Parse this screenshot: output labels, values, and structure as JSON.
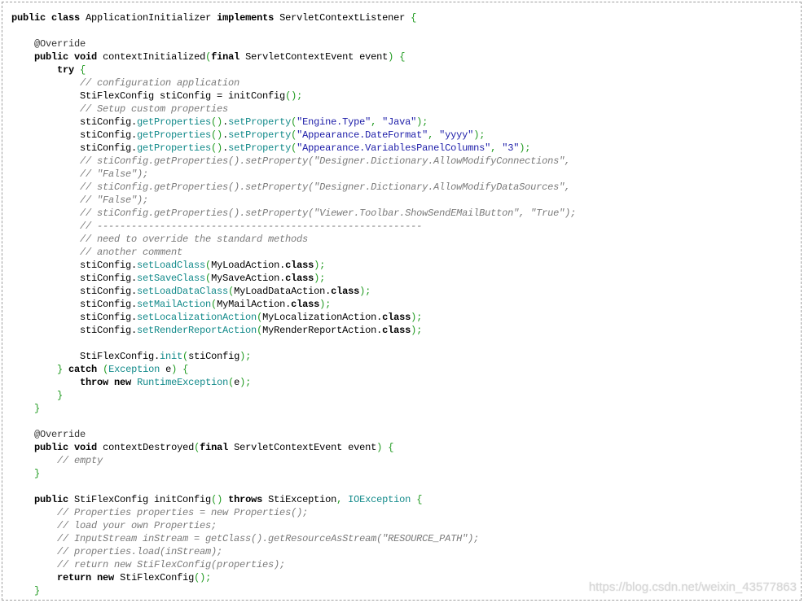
{
  "colors": {
    "keyword": "#000000",
    "comment": "#7a7a7a",
    "method": "#128a8a",
    "type": "#128a8a",
    "string": "#1c1ca8",
    "punctuation": "#1f9a1f",
    "text": "#000000",
    "annotation": "#333333",
    "border": "#a0a0a0",
    "watermark": "#d8d8d8"
  },
  "watermark": "https://blog.csdn.net/weixin_43577863",
  "code": {
    "language": "java",
    "lines": [
      [
        [
          "k",
          "public"
        ],
        [
          "t",
          " "
        ],
        [
          "k",
          "class"
        ],
        [
          "t",
          " ApplicationInitializer "
        ],
        [
          "k",
          "implements"
        ],
        [
          "t",
          " ServletContextListener "
        ],
        [
          "p",
          "{"
        ]
      ],
      [],
      [
        [
          "t",
          "    "
        ],
        [
          "a",
          "@Override"
        ]
      ],
      [
        [
          "t",
          "    "
        ],
        [
          "k",
          "public"
        ],
        [
          "t",
          " "
        ],
        [
          "k",
          "void"
        ],
        [
          "t",
          " contextInitialized"
        ],
        [
          "p",
          "("
        ],
        [
          "k",
          "final"
        ],
        [
          "t",
          " ServletContextEvent event"
        ],
        [
          "p",
          ")"
        ],
        [
          "t",
          " "
        ],
        [
          "p",
          "{"
        ]
      ],
      [
        [
          "t",
          "        "
        ],
        [
          "k",
          "try"
        ],
        [
          "t",
          " "
        ],
        [
          "p",
          "{"
        ]
      ],
      [
        [
          "t",
          "            "
        ],
        [
          "c",
          "// configuration application"
        ]
      ],
      [
        [
          "t",
          "            StiFlexConfig stiConfig = initConfig"
        ],
        [
          "p",
          "();"
        ]
      ],
      [
        [
          "t",
          "            "
        ],
        [
          "c",
          "// Setup custom properties"
        ]
      ],
      [
        [
          "t",
          "            stiConfig."
        ],
        [
          "m",
          "getProperties"
        ],
        [
          "p",
          "()"
        ],
        [
          "t",
          "."
        ],
        [
          "m",
          "setProperty"
        ],
        [
          "p",
          "("
        ],
        [
          "s",
          "\"Engine.Type\""
        ],
        [
          "p",
          ","
        ],
        [
          "t",
          " "
        ],
        [
          "s",
          "\"Java\""
        ],
        [
          "p",
          ");"
        ]
      ],
      [
        [
          "t",
          "            stiConfig."
        ],
        [
          "m",
          "getProperties"
        ],
        [
          "p",
          "()"
        ],
        [
          "t",
          "."
        ],
        [
          "m",
          "setProperty"
        ],
        [
          "p",
          "("
        ],
        [
          "s",
          "\"Appearance.DateFormat\""
        ],
        [
          "p",
          ","
        ],
        [
          "t",
          " "
        ],
        [
          "s",
          "\"yyyy\""
        ],
        [
          "p",
          ");"
        ]
      ],
      [
        [
          "t",
          "            stiConfig."
        ],
        [
          "m",
          "getProperties"
        ],
        [
          "p",
          "()"
        ],
        [
          "t",
          "."
        ],
        [
          "m",
          "setProperty"
        ],
        [
          "p",
          "("
        ],
        [
          "s",
          "\"Appearance.VariablesPanelColumns\""
        ],
        [
          "p",
          ","
        ],
        [
          "t",
          " "
        ],
        [
          "s",
          "\"3\""
        ],
        [
          "p",
          ");"
        ]
      ],
      [
        [
          "t",
          "            "
        ],
        [
          "c",
          "// stiConfig.getProperties().setProperty(\"Designer.Dictionary.AllowModifyConnections\","
        ]
      ],
      [
        [
          "t",
          "            "
        ],
        [
          "c",
          "// \"False\");"
        ]
      ],
      [
        [
          "t",
          "            "
        ],
        [
          "c",
          "// stiConfig.getProperties().setProperty(\"Designer.Dictionary.AllowModifyDataSources\","
        ]
      ],
      [
        [
          "t",
          "            "
        ],
        [
          "c",
          "// \"False\");"
        ]
      ],
      [
        [
          "t",
          "            "
        ],
        [
          "c",
          "// stiConfig.getProperties().setProperty(\"Viewer.Toolbar.ShowSendEMailButton\", \"True\");"
        ]
      ],
      [
        [
          "t",
          "            "
        ],
        [
          "c",
          "// ---------------------------------------------------------"
        ]
      ],
      [
        [
          "t",
          "            "
        ],
        [
          "c",
          "// need to override the standard methods"
        ]
      ],
      [
        [
          "t",
          "            "
        ],
        [
          "c",
          "// another comment"
        ]
      ],
      [
        [
          "t",
          "            stiConfig."
        ],
        [
          "m",
          "setLoadClass"
        ],
        [
          "p",
          "("
        ],
        [
          "t",
          "MyLoadAction."
        ],
        [
          "k",
          "class"
        ],
        [
          "p",
          ");"
        ]
      ],
      [
        [
          "t",
          "            stiConfig."
        ],
        [
          "m",
          "setSaveClass"
        ],
        [
          "p",
          "("
        ],
        [
          "t",
          "MySaveAction."
        ],
        [
          "k",
          "class"
        ],
        [
          "p",
          ");"
        ]
      ],
      [
        [
          "t",
          "            stiConfig."
        ],
        [
          "m",
          "setLoadDataClass"
        ],
        [
          "p",
          "("
        ],
        [
          "t",
          "MyLoadDataAction."
        ],
        [
          "k",
          "class"
        ],
        [
          "p",
          ");"
        ]
      ],
      [
        [
          "t",
          "            stiConfig."
        ],
        [
          "m",
          "setMailAction"
        ],
        [
          "p",
          "("
        ],
        [
          "t",
          "MyMailAction."
        ],
        [
          "k",
          "class"
        ],
        [
          "p",
          ");"
        ]
      ],
      [
        [
          "t",
          "            stiConfig."
        ],
        [
          "m",
          "setLocalizationAction"
        ],
        [
          "p",
          "("
        ],
        [
          "t",
          "MyLocalizationAction."
        ],
        [
          "k",
          "class"
        ],
        [
          "p",
          ");"
        ]
      ],
      [
        [
          "t",
          "            stiConfig."
        ],
        [
          "m",
          "setRenderReportAction"
        ],
        [
          "p",
          "("
        ],
        [
          "t",
          "MyRenderReportAction."
        ],
        [
          "k",
          "class"
        ],
        [
          "p",
          ");"
        ]
      ],
      [],
      [
        [
          "t",
          "            StiFlexConfig."
        ],
        [
          "m",
          "init"
        ],
        [
          "p",
          "("
        ],
        [
          "t",
          "stiConfig"
        ],
        [
          "p",
          ");"
        ]
      ],
      [
        [
          "t",
          "        "
        ],
        [
          "p",
          "}"
        ],
        [
          "t",
          " "
        ],
        [
          "k",
          "catch"
        ],
        [
          "t",
          " "
        ],
        [
          "p",
          "("
        ],
        [
          "b",
          "Exception"
        ],
        [
          "t",
          " e"
        ],
        [
          "p",
          ")"
        ],
        [
          "t",
          " "
        ],
        [
          "p",
          "{"
        ]
      ],
      [
        [
          "t",
          "            "
        ],
        [
          "k",
          "throw"
        ],
        [
          "t",
          " "
        ],
        [
          "k",
          "new"
        ],
        [
          "t",
          " "
        ],
        [
          "b",
          "RuntimeException"
        ],
        [
          "p",
          "("
        ],
        [
          "t",
          "e"
        ],
        [
          "p",
          ");"
        ]
      ],
      [
        [
          "t",
          "        "
        ],
        [
          "p",
          "}"
        ]
      ],
      [
        [
          "t",
          "    "
        ],
        [
          "p",
          "}"
        ]
      ],
      [],
      [
        [
          "t",
          "    "
        ],
        [
          "a",
          "@Override"
        ]
      ],
      [
        [
          "t",
          "    "
        ],
        [
          "k",
          "public"
        ],
        [
          "t",
          " "
        ],
        [
          "k",
          "void"
        ],
        [
          "t",
          " contextDestroyed"
        ],
        [
          "p",
          "("
        ],
        [
          "k",
          "final"
        ],
        [
          "t",
          " ServletContextEvent event"
        ],
        [
          "p",
          ")"
        ],
        [
          "t",
          " "
        ],
        [
          "p",
          "{"
        ]
      ],
      [
        [
          "t",
          "        "
        ],
        [
          "c",
          "// empty"
        ]
      ],
      [
        [
          "t",
          "    "
        ],
        [
          "p",
          "}"
        ]
      ],
      [],
      [
        [
          "t",
          "    "
        ],
        [
          "k",
          "public"
        ],
        [
          "t",
          " StiFlexConfig initConfig"
        ],
        [
          "p",
          "()"
        ],
        [
          "t",
          " "
        ],
        [
          "k",
          "throws"
        ],
        [
          "t",
          " StiException"
        ],
        [
          "p",
          ","
        ],
        [
          "t",
          " "
        ],
        [
          "b",
          "IOException"
        ],
        [
          "t",
          " "
        ],
        [
          "p",
          "{"
        ]
      ],
      [
        [
          "t",
          "        "
        ],
        [
          "c",
          "// Properties properties = new Properties();"
        ]
      ],
      [
        [
          "t",
          "        "
        ],
        [
          "c",
          "// load your own Properties;"
        ]
      ],
      [
        [
          "t",
          "        "
        ],
        [
          "c",
          "// InputStream inStream = getClass().getResourceAsStream(\"RESOURCE_PATH\");"
        ]
      ],
      [
        [
          "t",
          "        "
        ],
        [
          "c",
          "// properties.load(inStream);"
        ]
      ],
      [
        [
          "t",
          "        "
        ],
        [
          "c",
          "// return new StiFlexConfig(properties);"
        ]
      ],
      [
        [
          "t",
          "        "
        ],
        [
          "k",
          "return"
        ],
        [
          "t",
          " "
        ],
        [
          "k",
          "new"
        ],
        [
          "t",
          " StiFlexConfig"
        ],
        [
          "p",
          "();"
        ]
      ],
      [
        [
          "t",
          "    "
        ],
        [
          "p",
          "}"
        ]
      ]
    ]
  }
}
